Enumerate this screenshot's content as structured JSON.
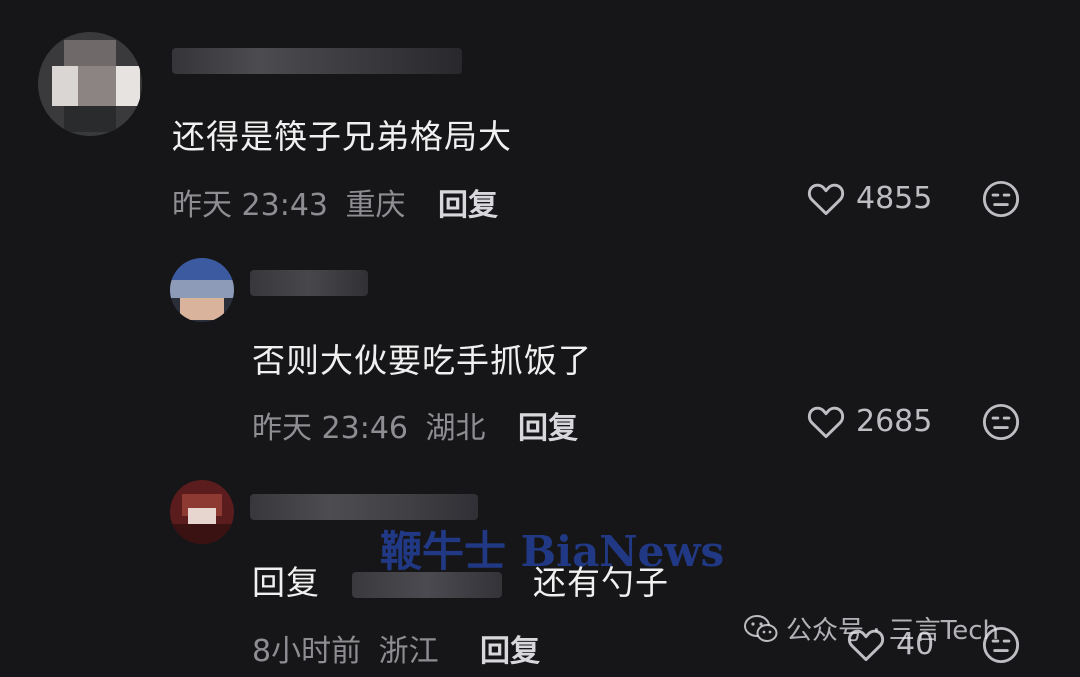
{
  "comments": [
    {
      "text": "还得是筷子兄弟格局大",
      "time": "昨天 23:43",
      "location": "重庆",
      "reply_label": "回复",
      "likes": "4855"
    },
    {
      "text": "否则大伙要吃手抓饭了",
      "time": "昨天 23:46",
      "location": "湖北",
      "reply_label": "回复",
      "likes": "2685"
    },
    {
      "reply_prefix": "回复",
      "text": "还有勺子",
      "time": "8小时前",
      "location": "浙江",
      "reply_label": "回复",
      "likes": "40"
    }
  ],
  "watermark": "鞭牛士 BiaNews",
  "wechat_mark": {
    "label": "公众号 · 三言Tech",
    "icon": "wechat-icon"
  },
  "icons": {
    "like": "heart-outline-icon",
    "dislike": "neutral-face-icon"
  },
  "colors": {
    "background": "#161618",
    "meta": "#8d8d92",
    "text": "#f0f0f0"
  }
}
